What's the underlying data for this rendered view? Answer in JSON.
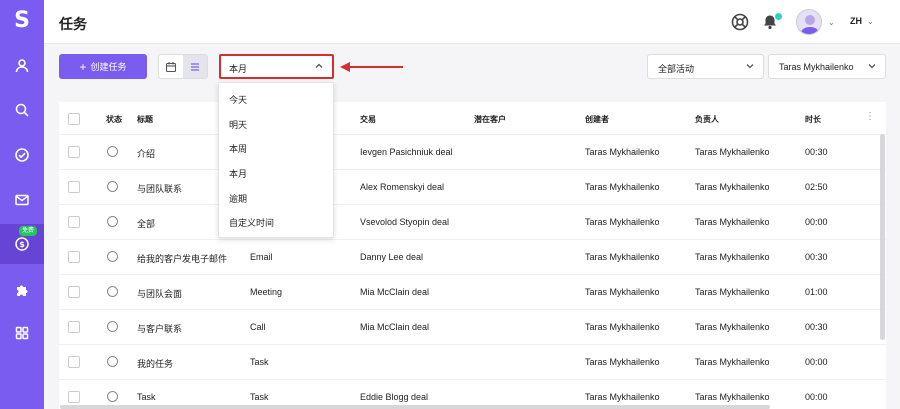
{
  "app": {
    "logo": "S"
  },
  "sidebar": {
    "items": [
      {
        "name": "contacts",
        "icon": "person-icon"
      },
      {
        "name": "search",
        "icon": "search-icon"
      },
      {
        "name": "tasks",
        "icon": "check-circle-icon"
      },
      {
        "name": "mail",
        "icon": "mail-icon"
      },
      {
        "name": "deals",
        "icon": "dollar-circle-icon",
        "badge": "免费",
        "active": true
      },
      {
        "name": "integrations",
        "icon": "puzzle-icon"
      },
      {
        "name": "apps",
        "icon": "grid-icon"
      }
    ]
  },
  "header": {
    "title": "任务",
    "language": "ZH"
  },
  "toolbar": {
    "create_label": "创建任务",
    "period_value": "本月",
    "activity_filter": "全部活动",
    "owner_filter": "Taras Mykhailenko"
  },
  "period_dropdown": {
    "options": [
      "今天",
      "明天",
      "本周",
      "本月",
      "逾期",
      "自定义时间"
    ]
  },
  "table": {
    "columns": {
      "status": "状态",
      "title": "标题",
      "deal": "交易",
      "lead": "潜在客户",
      "creator": "创建者",
      "assignee": "负责人",
      "duration": "时长"
    },
    "rows": [
      {
        "title": "介绍",
        "type": "",
        "deal": "Ievgen Pasichniuk deal",
        "creator": "Taras Mykhailenko",
        "assignee": "Taras Mykhailenko",
        "duration": "00:30"
      },
      {
        "title": "与团队联系",
        "type": "",
        "deal": "Alex Romenskyi deal",
        "creator": "Taras Mykhailenko",
        "assignee": "Taras Mykhailenko",
        "duration": "02:50"
      },
      {
        "title": "全部",
        "type": "",
        "deal": "Vsevolod Styopin deal",
        "creator": "Taras Mykhailenko",
        "assignee": "Taras Mykhailenko",
        "duration": "00:00"
      },
      {
        "title": "给我的客户发电子邮件",
        "type": "Email",
        "deal": "Danny Lee deal",
        "creator": "Taras Mykhailenko",
        "assignee": "Taras Mykhailenko",
        "duration": "00:30"
      },
      {
        "title": "与团队会面",
        "type": "Meeting",
        "deal": "Mia McClain deal",
        "creator": "Taras Mykhailenko",
        "assignee": "Taras Mykhailenko",
        "duration": "01:00"
      },
      {
        "title": "与客户联系",
        "type": "Call",
        "deal": "Mia McClain deal",
        "creator": "Taras Mykhailenko",
        "assignee": "Taras Mykhailenko",
        "duration": "00:30"
      },
      {
        "title": "我的任务",
        "type": "Task",
        "deal": "",
        "creator": "Taras Mykhailenko",
        "assignee": "Taras Mykhailenko",
        "duration": "00:00"
      },
      {
        "title": "Task",
        "type": "Task",
        "deal": "Eddie Blogg deal",
        "creator": "Taras Mykhailenko",
        "assignee": "Taras Mykhailenko",
        "duration": "00:00"
      }
    ]
  },
  "colors": {
    "brand": "#7b5cf0",
    "highlight": "#d32f2f",
    "online": "#2dd4bf",
    "badge": "#22c55e"
  }
}
